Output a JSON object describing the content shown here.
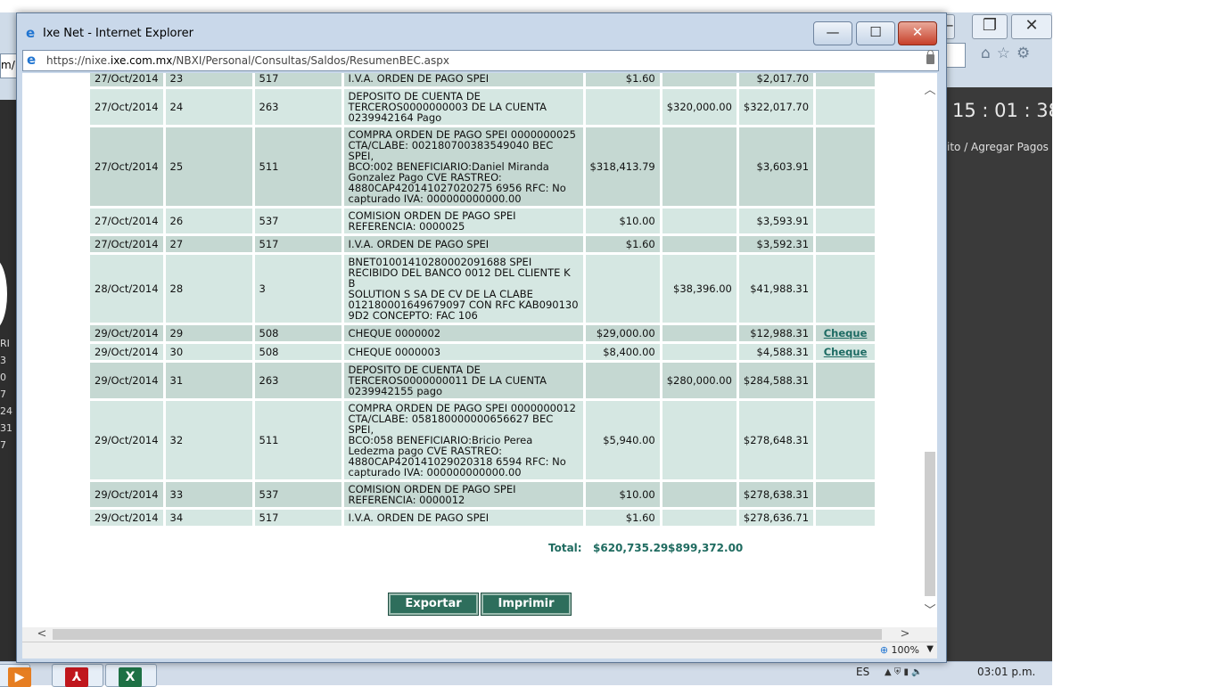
{
  "background": {
    "address_fragment": "m/",
    "clock": "15 : 01 : 38",
    "nav_text": "ito  /  Agregar Pagos",
    "side_numbers": [
      "RI",
      "3",
      "0",
      "7",
      "24",
      "31",
      "7"
    ]
  },
  "window": {
    "title": "Ixe Net - Internet Explorer",
    "url_prefix": "https://nixe.",
    "url_domain": "ixe.com.mx",
    "url_path": "/NBXI/Personal/Consultas/Saldos/ResumenBEC.aspx",
    "minimize_label": "—",
    "maximize_label": "☐",
    "close_label": "✕"
  },
  "table": {
    "rows": [
      {
        "date": "27/Oct/2014",
        "num": "23",
        "code": "517",
        "desc": "I.V.A. ORDEN DE PAGO SPEI",
        "cargo": "$1.60",
        "abono": "",
        "saldo": "$2,017.70",
        "link": ""
      },
      {
        "date": "27/Oct/2014",
        "num": "24",
        "code": "263",
        "desc": "DEPOSITO DE CUENTA DE\nTERCEROS0000000003 DE LA CUENTA\n0239942164 Pago",
        "cargo": "",
        "abono": "$320,000.00",
        "saldo": "$322,017.70",
        "link": ""
      },
      {
        "date": "27/Oct/2014",
        "num": "25",
        "code": "511",
        "desc": "COMPRA ORDEN DE PAGO SPEI 0000000025\nCTA/CLABE: 002180700383549040 BEC SPEI,\nBCO:002 BENEFICIARIO:Daniel Miranda\nGonzalez Pago CVE RASTREO:\n4880CAP420141027020275 6956 RFC: No\ncapturado IVA: 000000000000.00",
        "cargo": "$318,413.79",
        "abono": "",
        "saldo": "$3,603.91",
        "link": ""
      },
      {
        "date": "27/Oct/2014",
        "num": "26",
        "code": "537",
        "desc": "COMISION ORDEN DE PAGO SPEI\nREFERENCIA: 0000025",
        "cargo": "$10.00",
        "abono": "",
        "saldo": "$3,593.91",
        "link": ""
      },
      {
        "date": "27/Oct/2014",
        "num": "27",
        "code": "517",
        "desc": "I.V.A. ORDEN DE PAGO SPEI",
        "cargo": "$1.60",
        "abono": "",
        "saldo": "$3,592.31",
        "link": ""
      },
      {
        "date": "28/Oct/2014",
        "num": "28",
        "code": "3",
        "desc": "BNET01001410280002091688 SPEI\nRECIBIDO DEL BANCO 0012 DEL CLIENTE K B\nSOLUTION S SA DE CV DE LA CLABE\n012180001649679097 CON RFC KAB090130\n9D2 CONCEPTO: FAC 106",
        "cargo": "",
        "abono": "$38,396.00",
        "saldo": "$41,988.31",
        "link": ""
      },
      {
        "date": "29/Oct/2014",
        "num": "29",
        "code": "508",
        "desc": "CHEQUE 0000002",
        "cargo": "$29,000.00",
        "abono": "",
        "saldo": "$12,988.31",
        "link": "Cheque"
      },
      {
        "date": "29/Oct/2014",
        "num": "30",
        "code": "508",
        "desc": "CHEQUE 0000003",
        "cargo": "$8,400.00",
        "abono": "",
        "saldo": "$4,588.31",
        "link": "Cheque"
      },
      {
        "date": "29/Oct/2014",
        "num": "31",
        "code": "263",
        "desc": "DEPOSITO DE CUENTA DE\nTERCEROS0000000011 DE LA CUENTA\n0239942155 pago",
        "cargo": "",
        "abono": "$280,000.00",
        "saldo": "$284,588.31",
        "link": ""
      },
      {
        "date": "29/Oct/2014",
        "num": "32",
        "code": "511",
        "desc": "COMPRA ORDEN DE PAGO SPEI 0000000012\nCTA/CLABE: 058180000000656627 BEC SPEI,\nBCO:058 BENEFICIARIO:Bricio Perea\nLedezma pago CVE RASTREO:\n4880CAP420141029020318 6594 RFC: No\ncapturado IVA: 000000000000.00",
        "cargo": "$5,940.00",
        "abono": "",
        "saldo": "$278,648.31",
        "link": ""
      },
      {
        "date": "29/Oct/2014",
        "num": "33",
        "code": "537",
        "desc": "COMISION ORDEN DE PAGO SPEI\nREFERENCIA: 0000012",
        "cargo": "$10.00",
        "abono": "",
        "saldo": "$278,638.31",
        "link": ""
      },
      {
        "date": "29/Oct/2014",
        "num": "34",
        "code": "517",
        "desc": "I.V.A. ORDEN DE PAGO SPEI",
        "cargo": "$1.60",
        "abono": "",
        "saldo": "$278,636.71",
        "link": ""
      }
    ],
    "total_label": "Total:",
    "total_cargo": "$620,735.29",
    "total_abono": "$899,372.00"
  },
  "buttons": {
    "export_label": "Exportar",
    "print_label": "Imprimir"
  },
  "statusbar": {
    "zoom": "100%"
  },
  "taskbar": {
    "language": "ES",
    "time": "03:01 p.m."
  }
}
